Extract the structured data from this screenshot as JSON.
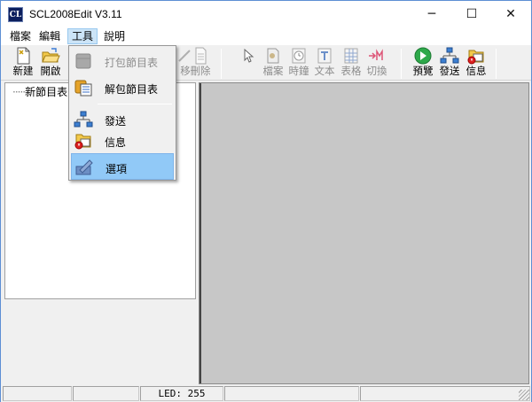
{
  "window": {
    "title": "SCL2008Edit V3.11",
    "icon_text": "CL",
    "minimize": "─",
    "maximize": "☐",
    "close": "✕"
  },
  "menu": {
    "items": [
      {
        "label": "檔案"
      },
      {
        "label": "編輯"
      },
      {
        "label": "工具"
      },
      {
        "label": "說明"
      }
    ]
  },
  "toolbar": {
    "new": "新建",
    "open": "開啟",
    "move": "移",
    "delete": "刪除",
    "file": "檔案",
    "clock": "時鐘",
    "text": "文本",
    "table": "表格",
    "switch": "切換",
    "preview": "預覽",
    "send": "發送",
    "info": "信息"
  },
  "tree": {
    "root": "新節目表",
    "dots": "·····"
  },
  "tools_menu": {
    "pack": "打包節目表",
    "unpack": "解包節目表",
    "send": "發送",
    "info": "信息",
    "options": "選項"
  },
  "status": {
    "led": "LED: 255"
  },
  "colors": {
    "accent": "#91c9f7",
    "title_icon": "#0c1f5e"
  }
}
